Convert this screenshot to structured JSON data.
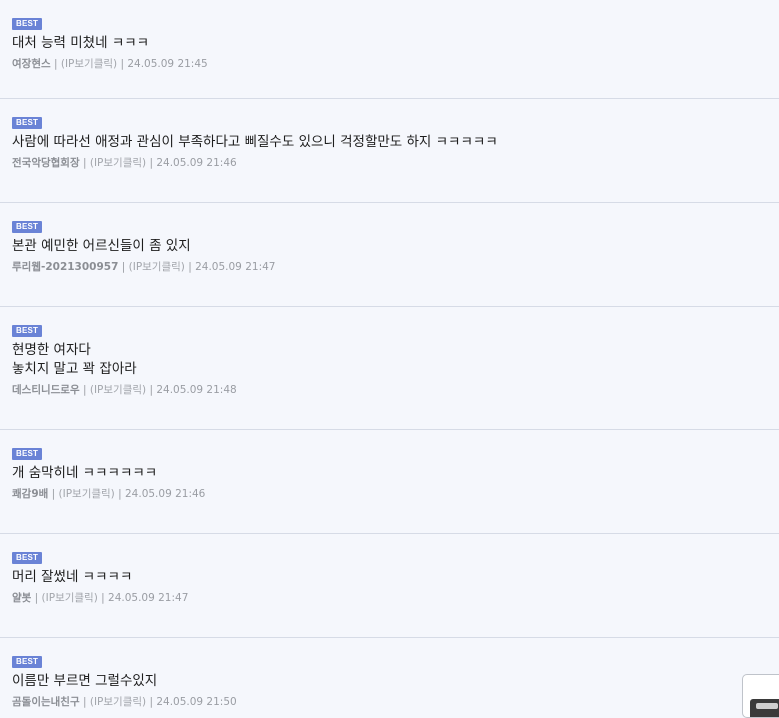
{
  "best_label": "BEST",
  "separator": " | ",
  "comments": [
    {
      "text": "대처 능력 미쳤네 ㅋㅋㅋ",
      "author": "여장현스",
      "ip": "(IP보기클릭)",
      "time": "24.05.09 21:45"
    },
    {
      "text": "사람에 따라선 애정과 관심이 부족하다고 삐질수도 있으니 걱정할만도 하지 ㅋㅋㅋㅋㅋ",
      "author": "전국악당협회장",
      "ip": "(IP보기클릭)",
      "time": "24.05.09 21:46"
    },
    {
      "text": "본관 예민한 어르신들이 좀 있지",
      "author": "루리웹-2021300957",
      "ip": "(IP보기클릭)",
      "time": "24.05.09 21:47"
    },
    {
      "text": "현명한 여자다\n놓치지 말고 꽉 잡아라",
      "author": "데스티니드로우",
      "ip": "(IP보기클릭)",
      "time": "24.05.09 21:48"
    },
    {
      "text": "개 숨막히네 ㅋㅋㅋㅋㅋㅋ",
      "author": "쾌감9배",
      "ip": "(IP보기클릭)",
      "time": "24.05.09 21:46"
    },
    {
      "text": "머리 잘썼네 ㅋㅋㅋㅋ",
      "author": "얄봇",
      "ip": "(IP보기클릭)",
      "time": "24.05.09 21:47"
    },
    {
      "text": "이름만 부르면 그럴수있지",
      "author": "곰돌이는내친구",
      "ip": "(IP보기클릭)",
      "time": "24.05.09 21:50"
    }
  ]
}
